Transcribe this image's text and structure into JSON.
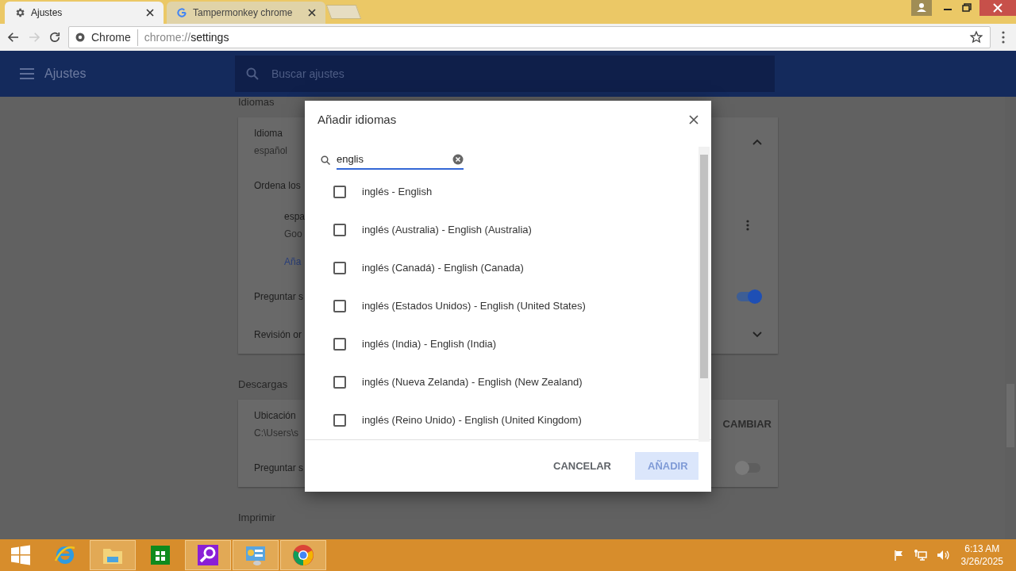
{
  "tabs": [
    {
      "title": "Ajustes",
      "selected": true
    },
    {
      "title": "Tampermonkey chrome",
      "selected": false
    }
  ],
  "omnibox": {
    "chip": "Chrome",
    "scheme": "chrome://",
    "path": "settings"
  },
  "app_bar": {
    "title": "Ajustes",
    "search_placeholder": "Buscar ajustes"
  },
  "sections": [
    {
      "heading": "Idiomas",
      "rows": [
        {
          "kind": "expand",
          "label": "Idioma",
          "sub": "español",
          "expanded": true
        },
        {
          "kind": "text",
          "label": "Ordena los"
        },
        {
          "kind": "menu",
          "label": "espa",
          "sub": "Goo"
        },
        {
          "kind": "link",
          "label": "Aña"
        },
        {
          "kind": "toggle",
          "label": "Preguntar s",
          "on": true
        },
        {
          "kind": "expand",
          "label": "Revisión or",
          "expanded": false
        }
      ]
    },
    {
      "heading": "Descargas",
      "rows": [
        {
          "kind": "button",
          "label": "Ubicación",
          "sub": "C:\\Users\\s",
          "action": "CAMBIAR"
        },
        {
          "kind": "toggle",
          "label": "Preguntar s",
          "on": false
        }
      ]
    },
    {
      "heading": "Imprimir"
    }
  ],
  "dialog": {
    "title": "Añadir idiomas",
    "search_value": "englis",
    "options": [
      {
        "label": "inglés - English",
        "checked": false
      },
      {
        "label": "inglés (Australia) - English (Australia)",
        "checked": false
      },
      {
        "label": "inglés (Canadá) - English (Canada)",
        "checked": false
      },
      {
        "label": "inglés (Estados Unidos) - English (United States)",
        "checked": false
      },
      {
        "label": "inglés (India) - English (India)",
        "checked": false
      },
      {
        "label": "inglés (Nueva Zelanda) - English (New Zealand)",
        "checked": false
      },
      {
        "label": "inglés (Reino Unido) - English (United Kingdom)",
        "checked": false
      }
    ],
    "cancel": "CANCELAR",
    "add": {
      "label": "AÑADIR",
      "disabled": true
    }
  },
  "taskbar": {
    "apps": [
      {
        "kind": "ie",
        "active": false
      },
      {
        "kind": "explorer",
        "active": true
      },
      {
        "kind": "store",
        "active": false
      },
      {
        "kind": "search",
        "active": true
      },
      {
        "kind": "control",
        "active": true
      },
      {
        "kind": "chrome",
        "active": true
      }
    ],
    "time": "6:13 AM",
    "date": "3/26/2025"
  }
}
